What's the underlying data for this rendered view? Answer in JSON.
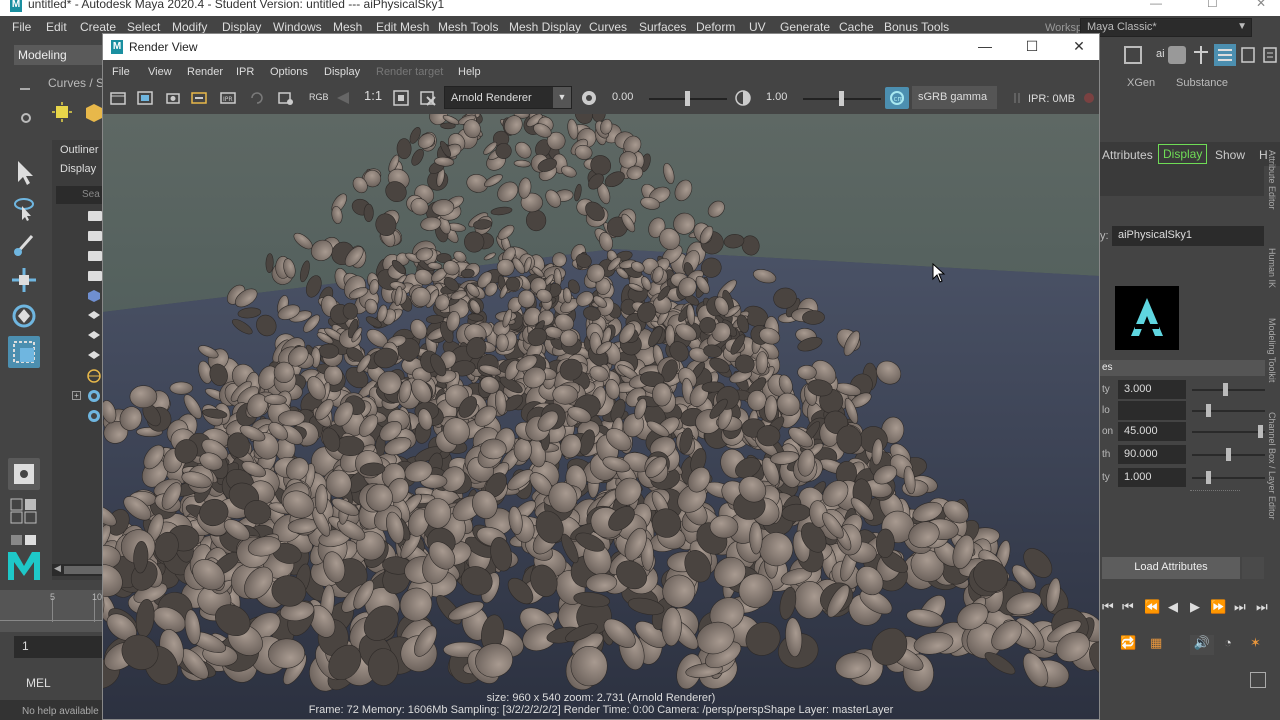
{
  "maya": {
    "title": "untitled* - Autodesk Maya 2020.4 - Student Version: untitled   ---   aiPhysicalSky1",
    "menu": [
      "File",
      "Edit",
      "Create",
      "Select",
      "Modify",
      "Display",
      "Windows",
      "Mesh",
      "Edit Mesh",
      "Mesh Tools",
      "Mesh Display",
      "Curves",
      "Surfaces",
      "Deform",
      "UV",
      "Generate",
      "Cache",
      "Bonus Tools"
    ],
    "workspace_label": "Workspace:",
    "workspace_value": "Maya Classic*",
    "menuset": "Modeling",
    "shelf_tab": "Curves / S",
    "outliner_title": "Outliner",
    "outliner_display": "Display",
    "outliner_search": "Sea",
    "frame_value": "1",
    "timeline_ticks": [
      "5",
      "10"
    ],
    "mel_label": "MEL",
    "help_line": "No help available"
  },
  "right_panel": {
    "tabs": [
      "XGen",
      "Substance"
    ],
    "attr_tabs": [
      "Attributes",
      "Display",
      "Show",
      "H"
    ],
    "node_prefix": "y:",
    "node_name": "aiPhysicalSky1",
    "section_header": "es",
    "attrs": [
      {
        "label": "ty",
        "value": "3.000",
        "knob": 0.45
      },
      {
        "label": "lo",
        "value": "",
        "knob": 0.2
      },
      {
        "label": "on",
        "value": "45.000",
        "knob": 0.97
      },
      {
        "label": "th",
        "value": "90.000",
        "knob": 0.5
      },
      {
        "label": "ty",
        "value": "1.000",
        "knob": 0.2
      }
    ],
    "load_attributes": "Load Attributes",
    "side_labels": [
      "Attribute Editor",
      "Human IK",
      "Modeling Toolkit",
      "Channel Box / Layer Editor"
    ]
  },
  "render_view": {
    "title": "Render View",
    "menu": [
      "File",
      "View",
      "Render",
      "IPR",
      "Options",
      "Display",
      "Render target",
      "Help"
    ],
    "menu_disabled": [
      "Render target"
    ],
    "toolbar": {
      "rgb": "RGB",
      "ratio": "1:1",
      "renderer": "Arnold Renderer",
      "exposure": "0.00",
      "gamma": "1.00",
      "colorspace": "sGRB gamma",
      "ipr": "IPR: 0MB"
    },
    "status_line1": "size: 960 x 540  zoom: 2.731     (Arnold Renderer)",
    "status_line2": "Frame: 72    Memory: 1606Mb    Sampling: [3/2/2/2/2/2]    Render Time: 0:00    Camera: /persp/perspShape    Layer: masterLayer"
  },
  "colors": {
    "accent_green": "#6fdc56",
    "accent_blue": "#4c8fb0",
    "maya_teal": "#1a8fa0"
  }
}
